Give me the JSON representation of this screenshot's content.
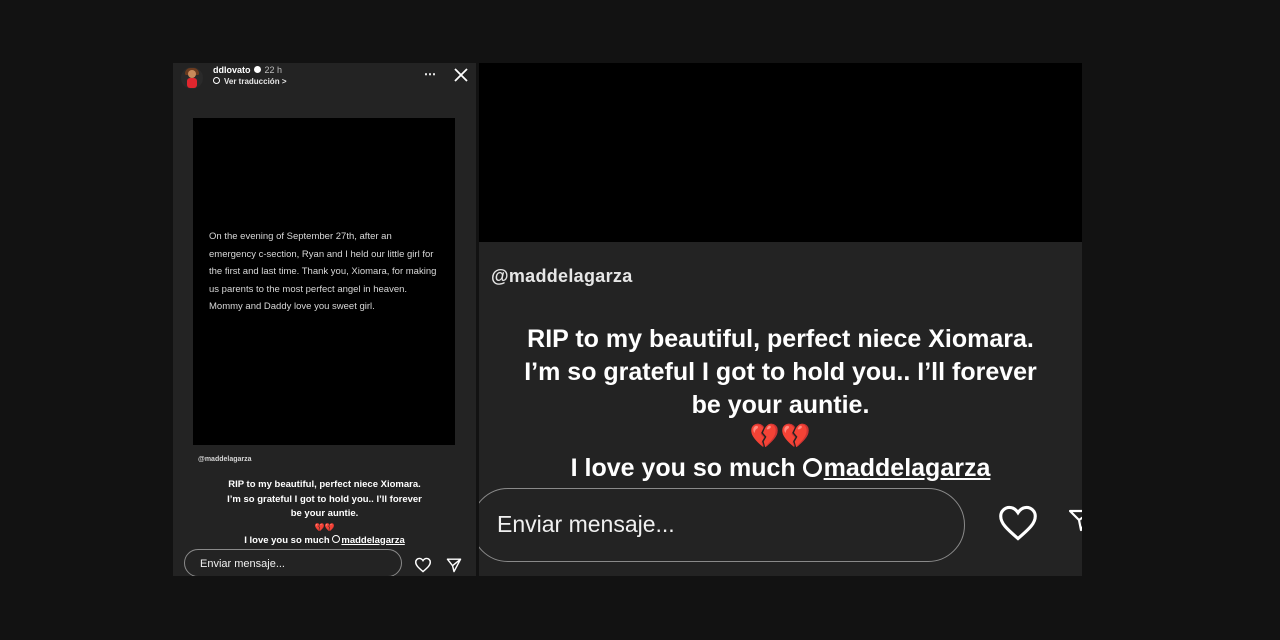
{
  "story_header": {
    "username": "ddlovato",
    "time": "22 h",
    "translate_label": "Ver traducción",
    "translate_chevron": ">",
    "more_icon": "⋯"
  },
  "post": {
    "text": "On the evening of September 27th, after an emergency c-section, Ryan and I held our little girl for the first and last time. Thank you, Xiomara, for making us parents to the most perfect angel in heaven. Mommy and Daddy love you sweet girl."
  },
  "story": {
    "mention": "@maddelagarza",
    "text_line_1": "RIP to my beautiful, perfect niece Xiomara.",
    "text_line_2": "I’m so grateful I got to hold you.. I’ll forever",
    "text_line_3": "be your auntie.",
    "hearts": "💔💔",
    "love_text": "I love you so much ",
    "tag": "maddelagarza"
  },
  "composer": {
    "placeholder": "Enviar mensaje..."
  },
  "colors": {
    "background": "#121212",
    "panel": "#232323",
    "card": "#000000",
    "text": "#ffffff",
    "broken_heart": "#e0262e"
  },
  "icons": [
    "close-icon",
    "more-icon",
    "verified-icon",
    "translate-icon",
    "heart-icon",
    "send-icon",
    "threads-icon",
    "broken-heart-icon"
  ]
}
